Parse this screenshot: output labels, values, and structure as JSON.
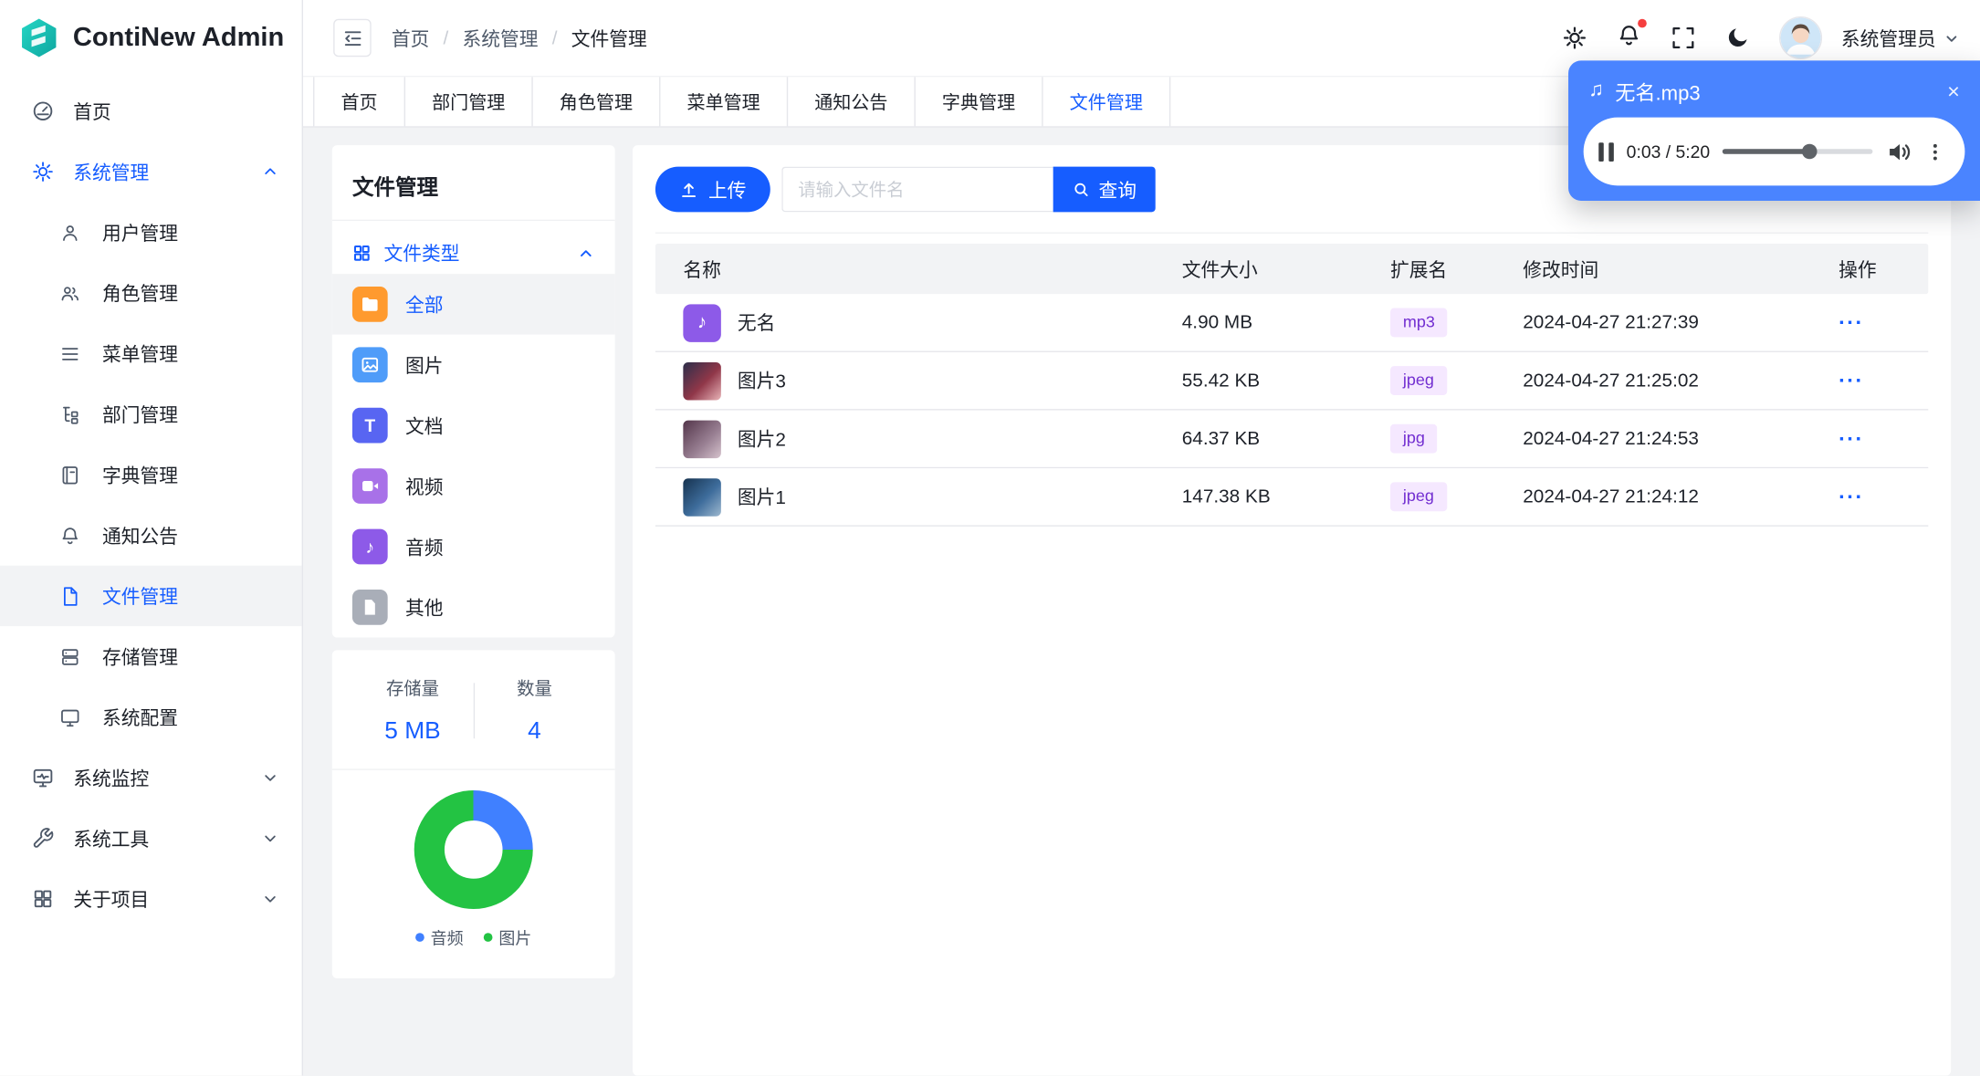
{
  "app": {
    "name": "ContiNew Admin"
  },
  "header": {
    "breadcrumb": [
      "首页",
      "系统管理",
      "文件管理"
    ],
    "user_name": "系统管理员"
  },
  "tabs": [
    "首页",
    "部门管理",
    "角色管理",
    "菜单管理",
    "通知公告",
    "字典管理",
    "文件管理"
  ],
  "active_tab": "文件管理",
  "sidebar": {
    "home": "首页",
    "groups": {
      "system_management": "系统管理",
      "system_monitor": "系统监控",
      "system_tools": "系统工具",
      "about_project": "关于项目"
    },
    "system_children": [
      "用户管理",
      "角色管理",
      "菜单管理",
      "部门管理",
      "字典管理",
      "通知公告",
      "文件管理",
      "存储管理",
      "系统配置"
    ],
    "active_item": "文件管理"
  },
  "file_panel": {
    "title": "文件管理",
    "group": "文件类型",
    "types": [
      "全部",
      "图片",
      "文档",
      "视频",
      "音频",
      "其他"
    ],
    "active_type": "全部",
    "stats": {
      "storage_label": "存储量",
      "storage_value": "5 MB",
      "count_label": "数量",
      "count_value": "4"
    }
  },
  "chart_data": {
    "type": "pie",
    "donut": true,
    "categories": [
      "音频",
      "图片"
    ],
    "values": [
      1,
      3
    ],
    "colors": [
      "#4080FF",
      "#23C343"
    ],
    "legend_position": "bottom"
  },
  "toolbar": {
    "upload": "上传",
    "search_placeholder": "请输入文件名",
    "query": "查询"
  },
  "table": {
    "columns": [
      "名称",
      "文件大小",
      "扩展名",
      "修改时间",
      "操作"
    ],
    "rows": [
      {
        "name": "无名",
        "size": "4.90 MB",
        "ext": "mp3",
        "modified": "2024-04-27 21:27:39",
        "type": "audio"
      },
      {
        "name": "图片3",
        "size": "55.42 KB",
        "ext": "jpeg",
        "modified": "2024-04-27 21:25:02",
        "type": "image"
      },
      {
        "name": "图片2",
        "size": "64.37 KB",
        "ext": "jpg",
        "modified": "2024-04-27 21:24:53",
        "type": "image"
      },
      {
        "name": "图片1",
        "size": "147.38 KB",
        "ext": "jpeg",
        "modified": "2024-04-27 21:24:12",
        "type": "image"
      }
    ],
    "row_actions": "···"
  },
  "player": {
    "title": "无名.mp3",
    "time": "0:03 / 5:20",
    "progress_percent": 58,
    "close": "×"
  },
  "glyphs": {
    "breadcrumb_sep": "/",
    "music_note": "♫",
    "audio_note": "♪",
    "doc_letter": "T"
  },
  "colors": {
    "primary": "#165DFF",
    "player_bg": "#4A84FF",
    "tag_bg": "#F5E8FF",
    "tag_text": "#722ED1",
    "danger_dot": "#F53F3F"
  }
}
